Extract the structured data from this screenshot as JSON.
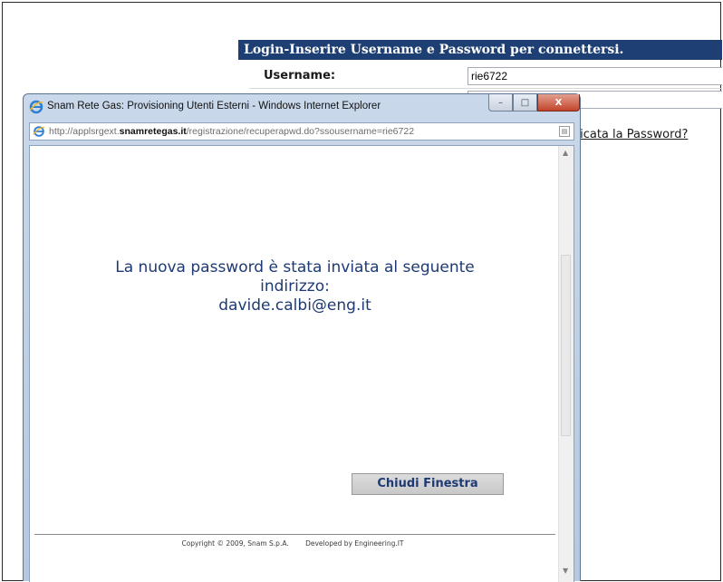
{
  "login": {
    "header": "Login-Inserire Username e Password per connettersi.",
    "username_label": "Username:",
    "username_value": "rie6722",
    "forgot_link": "ticata la Password?"
  },
  "popup": {
    "title": "Snam Rete Gas: Provisioning Utenti Esterni - Windows Internet Explorer",
    "window_controls": {
      "minimize": "–",
      "maximize": "□",
      "close": "X"
    },
    "address": {
      "prefix": "http://applsrgext.",
      "domain": "snamretegas.it",
      "suffix": "/registrazione/recuperapwd.do?ssousername=rie6722"
    },
    "message": {
      "line1": "La nuova password è stata inviata al seguente",
      "line2": "indirizzo:",
      "email": "davide.calbi@eng.it"
    },
    "close_button": "Chiudi Finestra",
    "footer": {
      "copyright": "Copyright © 2009, Snam S.p.A.",
      "developed": "Developed by Engineering.IT"
    }
  },
  "colors": {
    "header_bg": "#1e3f73",
    "message_text": "#1e3a74",
    "titlebar": "#c9d8ea",
    "close_red": "#c2452c"
  },
  "icons": [
    "ie-icon",
    "page-icon",
    "compat-icon"
  ]
}
